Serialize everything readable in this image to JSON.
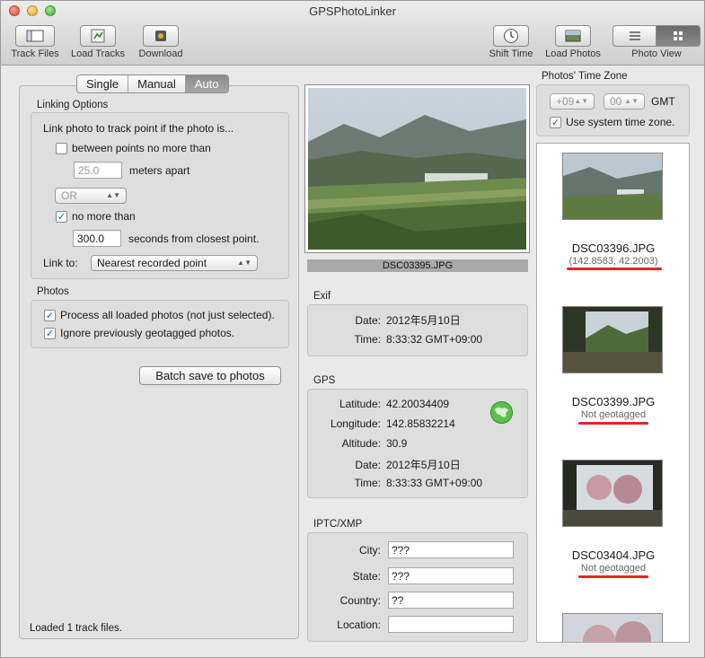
{
  "window": {
    "title": "GPSPhotoLinker"
  },
  "toolbar": {
    "track_files": "Track Files",
    "load_tracks": "Load Tracks",
    "download": "Download",
    "shift_time": "Shift Time",
    "load_photos": "Load Photos",
    "photo_view": "Photo View"
  },
  "mode": {
    "single": "Single",
    "manual": "Manual",
    "auto": "Auto",
    "selected": "Auto"
  },
  "linking": {
    "section": "Linking Options",
    "intro": "Link photo to track point if the photo is...",
    "between_label": "between points no more than",
    "between_checked": false,
    "meters_value": "25.0",
    "meters_suffix": "meters apart",
    "or_value": "OR",
    "nomore_label": "no more than",
    "nomore_checked": true,
    "seconds_value": "300.0",
    "seconds_suffix": "seconds from closest point.",
    "link_to_label": "Link to:",
    "link_to_value": "Nearest recorded point"
  },
  "photos_opts": {
    "section": "Photos",
    "process_all": "Process all loaded photos (not just selected).",
    "process_all_checked": true,
    "ignore_prev": "Ignore previously geotagged photos.",
    "ignore_prev_checked": true
  },
  "batch_button": "Batch save to photos",
  "status": "Loaded 1 track files.",
  "preview": {
    "caption": "DSC03395.JPG"
  },
  "exif": {
    "section": "Exif",
    "date_label": "Date:",
    "date": "2012年5月10日",
    "time_label": "Time:",
    "time": "8:33:32 GMT+09:00"
  },
  "gps": {
    "section": "GPS",
    "lat_label": "Latitude:",
    "lat": "42.20034409",
    "lon_label": "Longitude:",
    "lon": "142.85832214",
    "alt_label": "Altitude:",
    "alt": "30.9",
    "date_label": "Date:",
    "date": "2012年5月10日",
    "time_label": "Time:",
    "time": "8:33:33 GMT+09:00"
  },
  "iptc": {
    "section": "IPTC/XMP",
    "city_label": "City:",
    "city": "???",
    "state_label": "State:",
    "state": "???",
    "country_label": "Country:",
    "country": "??",
    "location_label": "Location:",
    "location": ""
  },
  "timezone": {
    "section": "Photos' Time Zone",
    "hours": "+09",
    "minutes": "00",
    "gmt": "GMT",
    "use_system": "Use system time zone.",
    "use_system_checked": true
  },
  "photo_list": [
    {
      "name": "DSC03396.JPG",
      "status": "(142.8583, 42.2003)"
    },
    {
      "name": "DSC03399.JPG",
      "status": "Not geotagged"
    },
    {
      "name": "DSC03404.JPG",
      "status": "Not geotagged"
    }
  ],
  "colors": {
    "underline": "#e0281e",
    "checkmark": "#1a56c7"
  }
}
